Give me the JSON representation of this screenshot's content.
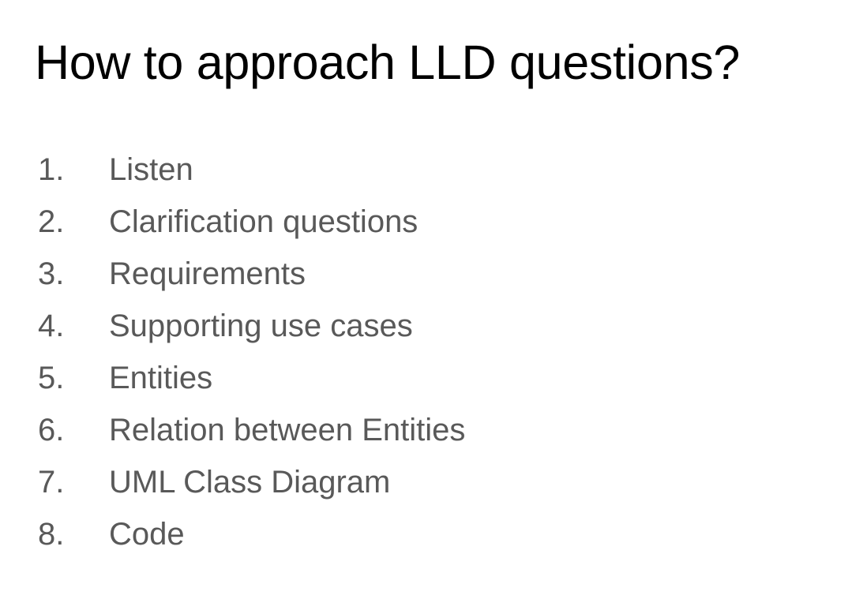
{
  "slide": {
    "title": "How to approach LLD questions?",
    "steps": [
      {
        "number": "1.",
        "text": "Listen"
      },
      {
        "number": "2.",
        "text": "Clarification questions"
      },
      {
        "number": "3.",
        "text": "Requirements"
      },
      {
        "number": "4.",
        "text": "Supporting use cases"
      },
      {
        "number": "5.",
        "text": "Entities"
      },
      {
        "number": "6.",
        "text": "Relation between Entities"
      },
      {
        "number": "7.",
        "text": "UML Class Diagram"
      },
      {
        "number": "8.",
        "text": "Code"
      }
    ]
  },
  "colors": {
    "background": "#ffffff",
    "title": "#000000",
    "list_text": "#595959"
  }
}
